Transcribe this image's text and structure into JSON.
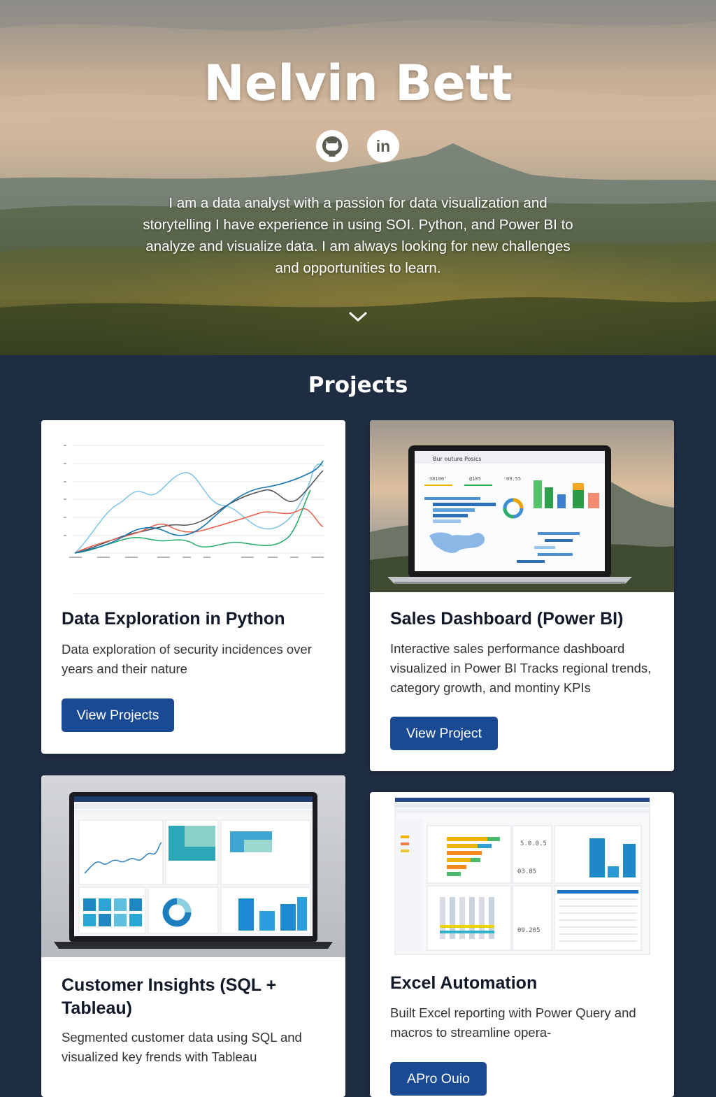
{
  "hero": {
    "name": "Nelvin Bett",
    "social": [
      {
        "icon": "github-icon",
        "label": ""
      },
      {
        "icon": "linkedin-icon",
        "label": "in"
      }
    ],
    "bio": "I am a data analyst with a passion for data visualization and storytelling  I have experience in using SOI. Python, and Power BI to analyze and visualize data. I am always looking for new challenges and opportunities to learn.",
    "scroll_icon": "chevron-down-icon"
  },
  "projects": {
    "heading": "Projects",
    "items": [
      {
        "title": "Data Exploration in Python",
        "description": "Data exploration of security incidences over years and their nature",
        "button": "View Projects"
      },
      {
        "title": "Sales Dashboard (Power BI)",
        "description": "Interactive sales performance dashboard visualized in Power BI  Tracks regional trends, category growth, and montiny KPIs",
        "button": "View Project",
        "screen_title": "Bur outure Posics",
        "screen_kpis": [
          "30100'",
          "@105",
          "09.55"
        ]
      },
      {
        "title": "Customer Insights (SQL + Tableau)",
        "description": "Segmented customer data using SQL and visualized key frends with Tableau"
      },
      {
        "title": "Excel Automation",
        "description": "Built Excel reporting with Power Query and macros to streamline opera-",
        "button": "APro Ouio",
        "screen_kpis": [
          "5.0.0.5",
          "03.85",
          "09.205"
        ]
      }
    ]
  },
  "colors": {
    "section_bg": "#1f2d43",
    "button_bg": "#1a4a94",
    "card_bg": "#ffffff"
  }
}
